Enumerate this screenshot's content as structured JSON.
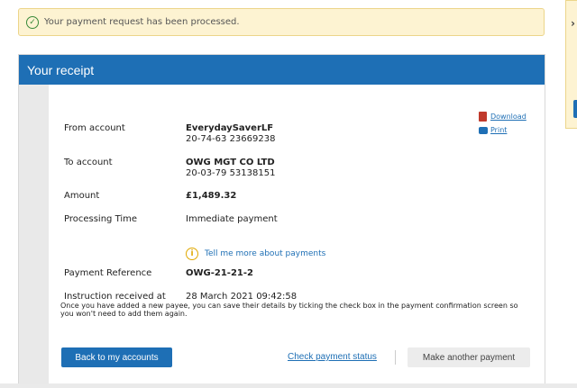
{
  "notice": {
    "message": "Your payment request has been processed."
  },
  "receipt": {
    "title": "Your receipt",
    "download_label": "Download",
    "print_label": "Print",
    "from_account": {
      "label": "From account",
      "name": "EverydaySaverLF",
      "number": "20-74-63 23669238"
    },
    "to_account": {
      "label": "To account",
      "name": "OWG MGT CO LTD",
      "number": "20-03-79 53138151"
    },
    "amount": {
      "label": "Amount",
      "value": "£1,489.32"
    },
    "processing_time": {
      "label": "Processing Time",
      "value": "Immediate payment"
    },
    "info_link": "Tell me more about payments",
    "payment_reference": {
      "label": "Payment Reference",
      "value": "OWG-21-21-2"
    },
    "instruction_received": {
      "label": "Instruction received at",
      "value": "28 March 2021 09:42:58"
    },
    "payee_note": "Once you have added a new payee, you can save their details by ticking the check box in the payment confirmation screen so you won't need to add them again.",
    "back_button": "Back to my accounts",
    "check_status_link": "Check payment status",
    "another_payment_button": "Make another payment"
  },
  "colors": {
    "brand_blue": "#1e6fb5",
    "notice_bg": "#fdf3d2",
    "success_green": "#3a8a3a"
  }
}
